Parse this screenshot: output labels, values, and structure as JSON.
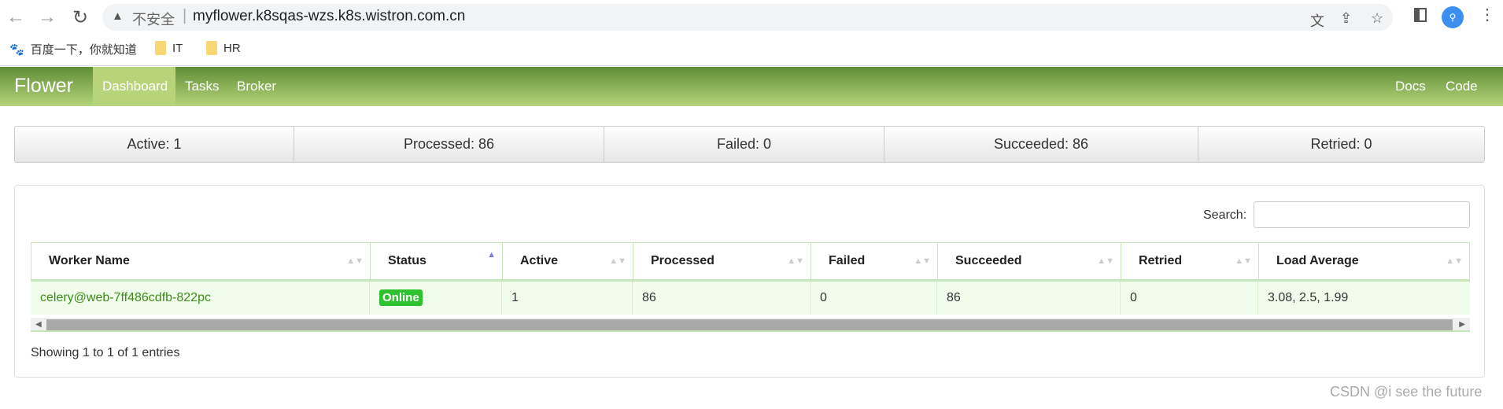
{
  "browser": {
    "back": "←",
    "forward": "→",
    "reload": "↻",
    "insecure_label": "不安全",
    "url": "myflower.k8sqas-wzs.k8s.wistron.com.cn",
    "bookmarks": [
      {
        "label": "百度一下，你就知道",
        "icon": "baidu-icon"
      },
      {
        "label": "IT",
        "icon": "folder-icon"
      },
      {
        "label": "HR",
        "icon": "folder-icon"
      }
    ]
  },
  "navbar": {
    "brand": "Flower",
    "items": [
      {
        "label": "Dashboard",
        "active": true
      },
      {
        "label": "Tasks"
      },
      {
        "label": "Broker"
      }
    ],
    "right": [
      {
        "label": "Docs"
      },
      {
        "label": "Code"
      }
    ]
  },
  "stats": [
    "Active: 1",
    "Processed: 86",
    "Failed: 0",
    "Succeeded: 86",
    "Retried: 0"
  ],
  "search": {
    "label": "Search:",
    "value": ""
  },
  "table": {
    "columns": [
      "Worker Name",
      "Status",
      "Active",
      "Processed",
      "Failed",
      "Succeeded",
      "Retried",
      "Load Average"
    ],
    "rows": [
      [
        "celery@web-7ff486cdfb-822pc",
        "Online",
        "1",
        "86",
        "0",
        "86",
        "0",
        "3.08, 2.5, 1.99"
      ]
    ]
  },
  "footer": {
    "info": "Showing 1 to 1 of 1 entries"
  },
  "watermark": "CSDN @i see the future",
  "colors": {
    "navbar": "#6a9a3c",
    "online": "#2fc22f",
    "row": "#f0fdeb"
  }
}
